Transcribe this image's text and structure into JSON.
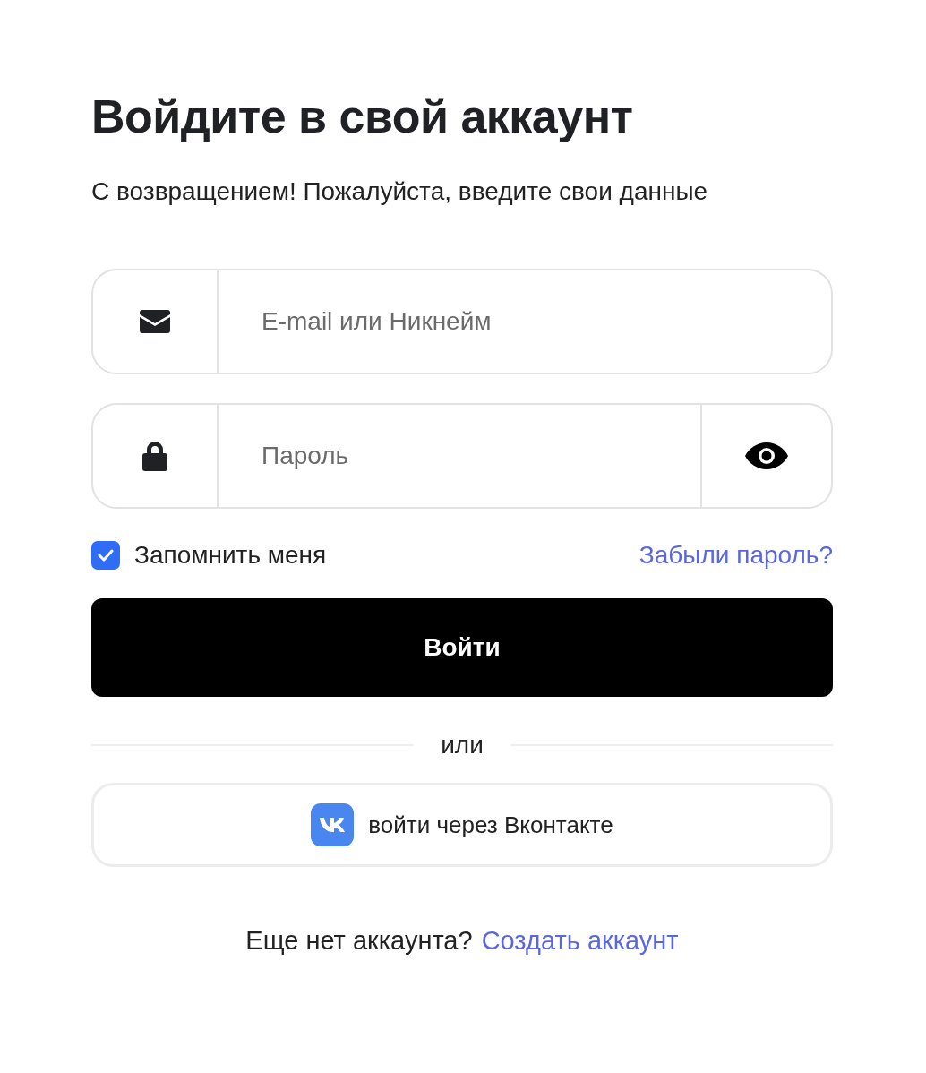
{
  "heading": "Войдите в свой аккаунт",
  "subtitle": "С возвращением! Пожалуйста, введите свои данные",
  "fields": [
    {
      "kind": "login",
      "placeholder": "E-mail или Никнейм"
    },
    {
      "kind": "password",
      "placeholder": "Пароль"
    }
  ],
  "remember": {
    "label": "Запомнить меня",
    "checked": true
  },
  "forgot_link": "Забыли пароль?",
  "submit_button": "Войти",
  "divider": "или",
  "vk_button": "войти через Вконтакте",
  "signup": {
    "text": "Еще нет аккаунта?",
    "link": "Создать аккаунт"
  }
}
